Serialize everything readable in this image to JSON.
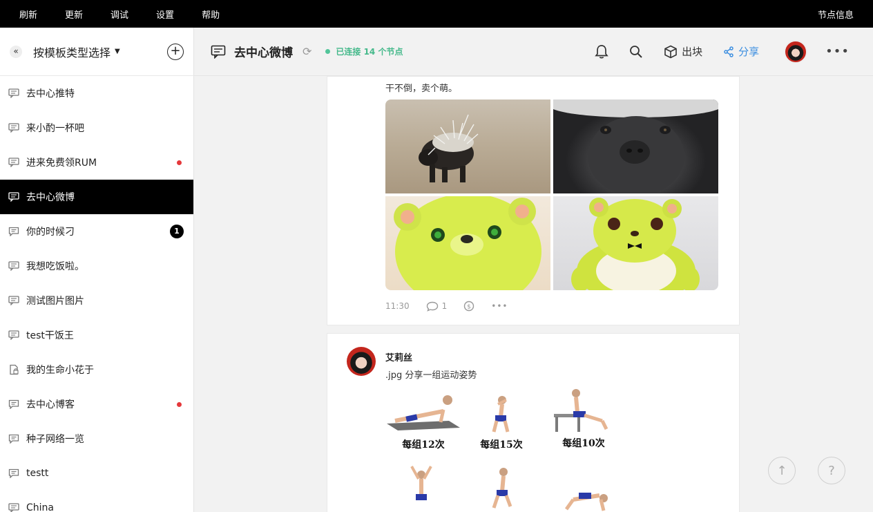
{
  "topbar": {
    "menu": [
      "刷新",
      "更新",
      "调试",
      "设置",
      "帮助"
    ],
    "node_info": "节点信息"
  },
  "sidebar": {
    "collapse_label": "«",
    "template_select": "按模板类型选择",
    "add_label": "+",
    "channels": [
      {
        "label": "去中心推特",
        "icon": "chat-icon",
        "badge": null
      },
      {
        "label": "来小酌一杯吧",
        "icon": "chat-icon",
        "badge": null
      },
      {
        "label": "进来免费领RUM",
        "icon": "chat-icon",
        "badge": "dot"
      },
      {
        "label": "去中心微博",
        "icon": "chat-icon",
        "badge": null,
        "active": true
      },
      {
        "label": "你的时候刁",
        "icon": "comment-icon",
        "badge": "1"
      },
      {
        "label": "我想吃饭啦。",
        "icon": "chat-icon",
        "badge": null
      },
      {
        "label": "测试图片图片",
        "icon": "chat-icon",
        "badge": null
      },
      {
        "label": "test干饭王",
        "icon": "chat-icon",
        "badge": null
      },
      {
        "label": "我的生命小花于",
        "icon": "note-lock-icon",
        "badge": null
      },
      {
        "label": "去中心博客",
        "icon": "comment-icon",
        "badge": "dot"
      },
      {
        "label": "种子网络一览",
        "icon": "comment-icon",
        "badge": null
      },
      {
        "label": "testt",
        "icon": "comment-icon",
        "badge": null
      },
      {
        "label": "China",
        "icon": "chat-icon",
        "badge": null
      }
    ]
  },
  "header": {
    "title": "去中心微博",
    "connection": "已连接 14 个节点",
    "block_label": "出块",
    "share_label": "分享",
    "more_label": "•••"
  },
  "feed": {
    "post1": {
      "text": "干不倒，卖个萌。",
      "time": "11:30",
      "comment_count": "1",
      "more_label": "•••"
    },
    "post2": {
      "author": "艾莉丝",
      "text": ".jpg 分享一组运动姿势",
      "captions": [
        "每组12次",
        "每组15次",
        "每组10次"
      ]
    }
  },
  "floating": {
    "scroll_top": "↑",
    "help": "?"
  },
  "colors": {
    "accent_share": "#3a8de0",
    "connected": "#45b98b",
    "unread_dot": "#e5383b"
  }
}
